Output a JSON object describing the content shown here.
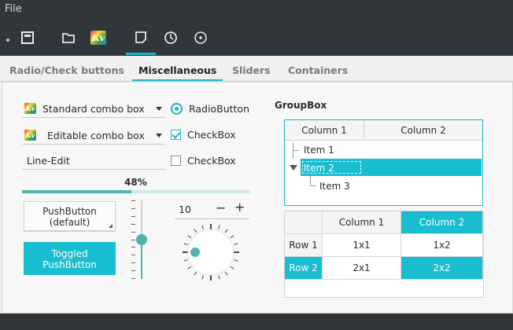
{
  "menu": {
    "file": "File"
  },
  "toolbar": {
    "icons": [
      "dot-handle",
      "window-icon",
      "folder-icon",
      "kv-logo",
      "new-page-icon",
      "clock-icon",
      "record-icon"
    ],
    "kv_text": "Kv"
  },
  "tabs": [
    {
      "label": "Radio/Check buttons",
      "selected": false
    },
    {
      "label": "Miscellaneous",
      "selected": true
    },
    {
      "label": "Sliders",
      "selected": false
    },
    {
      "label": "Containers",
      "selected": false
    }
  ],
  "combos": {
    "standard": "Standard combo box",
    "editable": "Editable combo box"
  },
  "line_edit": {
    "value": "Line-Edit"
  },
  "radio": {
    "label": "RadioButton",
    "checked": true
  },
  "checkbox1": {
    "label": "CheckBox",
    "checked": true
  },
  "checkbox2": {
    "label": "CheckBox",
    "checked": false
  },
  "progress": {
    "value_text": "48%",
    "value": 48
  },
  "buttons": {
    "default_line1": "PushButton",
    "default_line2": "(default)",
    "toggled_line1": "Toggled",
    "toggled_line2": "PushButton"
  },
  "vslider": {
    "value": 0.5
  },
  "spinbox": {
    "value": "10",
    "minus": "−",
    "plus": "+"
  },
  "dial": {
    "value": 0.2
  },
  "groupbox": {
    "title": "GroupBox",
    "tree": {
      "columns": [
        "Column 1",
        "Column 2"
      ],
      "items": [
        "Item 1",
        "Item 2",
        "Item 3"
      ]
    },
    "table": {
      "columns": [
        "Column 1",
        "Column 2"
      ],
      "rows": [
        {
          "header": "Row 1",
          "cells": [
            "1x1",
            "1x2"
          ]
        },
        {
          "header": "Row 2",
          "cells": [
            "2x1",
            "2x2"
          ]
        }
      ]
    }
  },
  "colors": {
    "accent": "#19b6c8",
    "dark_bg": "#31363b",
    "slider": "#4cb6ac"
  }
}
